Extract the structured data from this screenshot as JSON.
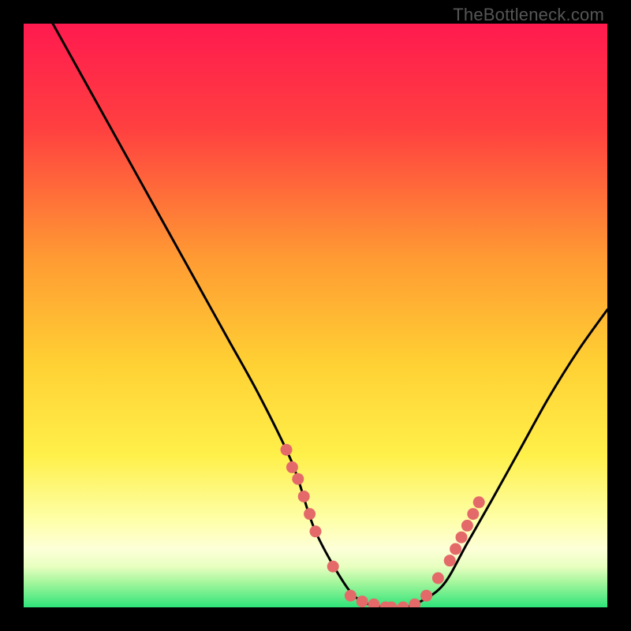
{
  "watermark": "TheBottleneck.com",
  "colors": {
    "gradient_top": "#ff1a4f",
    "gradient_mid_upper": "#ff7a33",
    "gradient_mid": "#ffd033",
    "gradient_mid_lower": "#fff04a",
    "gradient_pale": "#fdffc8",
    "gradient_bottom": "#2fe47a",
    "curve": "#000000",
    "dots": "#e46a6a",
    "background": "#000000"
  },
  "chart_data": {
    "type": "line",
    "title": "",
    "xlabel": "",
    "ylabel": "",
    "xlim": [
      0,
      100
    ],
    "ylim": [
      0,
      100
    ],
    "series": [
      {
        "name": "bottleneck-curve",
        "x": [
          5,
          10,
          15,
          20,
          25,
          30,
          35,
          40,
          45,
          47,
          50,
          55,
          58,
          62,
          65,
          68,
          72,
          76,
          80,
          85,
          90,
          95,
          100
        ],
        "y": [
          100,
          91,
          82,
          73,
          64,
          55,
          46,
          37,
          27,
          22,
          13,
          4,
          1,
          0,
          0,
          1,
          4,
          11,
          18,
          27,
          36,
          44,
          51
        ]
      }
    ],
    "dots_left": {
      "x": [
        45,
        46,
        47,
        48,
        49,
        50,
        53
      ],
      "y": [
        27,
        24,
        22,
        19,
        16,
        13,
        7
      ]
    },
    "dots_bottom": {
      "x": [
        56,
        58,
        60,
        62,
        63,
        65,
        67,
        69
      ],
      "y": [
        2,
        1,
        0.5,
        0,
        0,
        0,
        0.5,
        2
      ]
    },
    "dots_right": {
      "x": [
        71,
        73,
        74,
        75,
        76,
        77,
        78
      ],
      "y": [
        5,
        8,
        10,
        12,
        14,
        16,
        18
      ]
    }
  }
}
